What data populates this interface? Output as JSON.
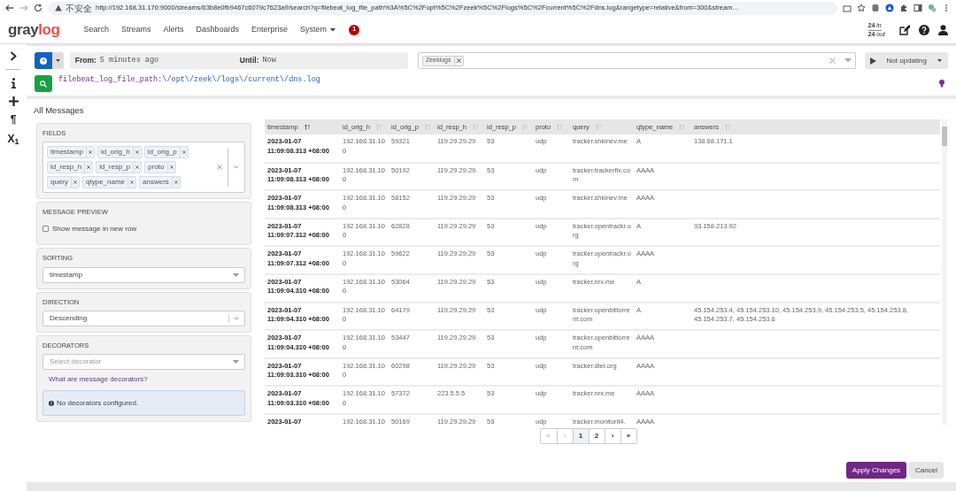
{
  "browser": {
    "security_label": "不安全",
    "url": "http://192.168.31.170:9000/streams/63b8e0fb9467c6079c7623a9/search?q=filebeat_log_file_path%3A%5C%2Fopt%5C%2Fzeek%5C%2Flogs%5C%2Fcurrent%5C%2Fdns.log&rangetype=relative&from=300&stream…"
  },
  "navbar": {
    "logo": {
      "dark": "gray",
      "accent": "log"
    },
    "items": [
      {
        "label": "Search",
        "dropdown": false
      },
      {
        "label": "Streams",
        "dropdown": false
      },
      {
        "label": "Alerts",
        "dropdown": false
      },
      {
        "label": "Dashboards",
        "dropdown": false
      },
      {
        "label": "Enterprise",
        "dropdown": false
      },
      {
        "label": "System",
        "dropdown": true
      }
    ],
    "notification_badge": "1",
    "throughput": {
      "in_count": "24",
      "in_label": "in",
      "out_count": "24",
      "out_label": "out"
    }
  },
  "sidebar": {
    "items": [
      {
        "kind": "chevron"
      },
      {
        "kind": "info"
      },
      {
        "kind": "plus"
      },
      {
        "kind": "text",
        "label": "¶"
      },
      {
        "kind": "text",
        "label": "X$_{1}$"
      }
    ]
  },
  "search": {
    "from_label": "From:",
    "from_value": "5 minutes ago",
    "until_label": "Until:",
    "until_value": "Now",
    "streams": [
      "Zeeklogs"
    ],
    "refresh_label": "Not updating",
    "query_field": "filebeat_log_file_path:",
    "query_value": "\\/opt\\/zeek\\/logs\\/current\\/dns.log"
  },
  "panel_title": "All Messages",
  "settings": {
    "fields": {
      "title": "FIELDS",
      "tags": [
        "timestamp",
        "id_orig_h",
        "id_orig_p",
        "id_resp_h",
        "id_resp_p",
        "proto",
        "query",
        "qtype_name",
        "answers"
      ]
    },
    "preview": {
      "title": "MESSAGE PREVIEW",
      "checkbox_label": "Show message in new row",
      "checked": false
    },
    "sorting": {
      "title": "SORTING",
      "value": "timestamp"
    },
    "direction": {
      "title": "DIRECTION",
      "value": "Descending"
    },
    "decorators": {
      "title": "DECORATORS",
      "placeholder": "Select decorator",
      "help_link": "What are message decorators?",
      "info": "No decorators configured."
    }
  },
  "table": {
    "columns": [
      "timestamp",
      "id_orig_h",
      "id_orig_p",
      "id_resp_h",
      "id_resp_p",
      "proto",
      "query",
      "qtype_name",
      "answers"
    ],
    "rows": [
      {
        "cells": [
          "2023-01-07 11:09:08.313 +08:00",
          "192.168.31.100",
          "59321",
          "119.29.29.29",
          "53",
          "udp",
          "tracker.shkinev.me",
          "A",
          "138.68.171.1"
        ]
      },
      {
        "cells": [
          "2023-01-07 11:09:08.313 +08:00",
          "192.168.31.100",
          "50192",
          "119.29.29.29",
          "53",
          "udp",
          "tracker.trackerfix.com",
          "AAAA"
        ]
      },
      {
        "cells": [
          "2023-01-07 11:09:08.313 +08:00",
          "192.168.31.100",
          "58152",
          "119.29.29.29",
          "53",
          "udp",
          "tracker.shkinev.me",
          "AAAA"
        ]
      },
      {
        "cells": [
          "2023-01-07 11:09:07.312 +08:00",
          "192.168.31.100",
          "62828",
          "119.29.29.29",
          "53",
          "udp",
          "tracker.opentrackr.org",
          "A",
          "93.158.213.92"
        ]
      },
      {
        "cells": [
          "2023-01-07 11:09:07.312 +08:00",
          "192.168.31.100",
          "59622",
          "119.29.29.29",
          "53",
          "udp",
          "tracker.opentrackr.org",
          "AAAA"
        ]
      },
      {
        "cells": [
          "2023-01-07 11:09:04.310 +08:00",
          "192.168.31.100",
          "53064",
          "119.29.29.29",
          "53",
          "udp",
          "tracker.nrx.me",
          "A"
        ]
      },
      {
        "cells": [
          "2023-01-07 11:09:04.310 +08:00",
          "192.168.31.100",
          "64179",
          "119.29.29.29",
          "53",
          "udp",
          "tracker.openbittorrent.com",
          "A",
          "45.154.253.4, 45.154.253.10, 45.154.253.9, 45.154.253.5, 45.154.253.8, 45.154.253.7, 45.154.253.6"
        ]
      },
      {
        "cells": [
          "2023-01-07 11:09:04.310 +08:00",
          "192.168.31.100",
          "53447",
          "119.29.29.29",
          "53",
          "udp",
          "tracker.openbittorrent.com",
          "AAAA"
        ]
      },
      {
        "cells": [
          "2023-01-07 11:09:03.310 +08:00",
          "192.168.31.100",
          "60298",
          "119.29.29.29",
          "53",
          "udp",
          "tracker.dler.org",
          "AAAA"
        ]
      },
      {
        "cells": [
          "2023-01-07 11:09:03.310 +08:00",
          "192.168.31.100",
          "57372",
          "223.5.5.5",
          "53",
          "udp",
          "tracker.nrx.me",
          "AAAA"
        ]
      },
      {
        "cells": [
          "2023-01-07",
          "192.168.31.10",
          "50169",
          "119.29.29.29",
          "53",
          "udp",
          "tracker.monitorit4.",
          "AAAA"
        ]
      }
    ]
  },
  "pagination": [
    {
      "label": "«",
      "selected": false,
      "disabled": true
    },
    {
      "label": "‹",
      "selected": false,
      "disabled": true
    },
    {
      "label": "1",
      "selected": true,
      "disabled": false
    },
    {
      "label": "2",
      "selected": false,
      "disabled": false
    },
    {
      "label": "›",
      "selected": false,
      "disabled": false
    },
    {
      "label": "»",
      "selected": false,
      "disabled": false
    }
  ],
  "buttons": [
    {
      "label": "Apply Changes",
      "kind": "primary"
    },
    {
      "label": "Cancel",
      "kind": "default"
    }
  ]
}
